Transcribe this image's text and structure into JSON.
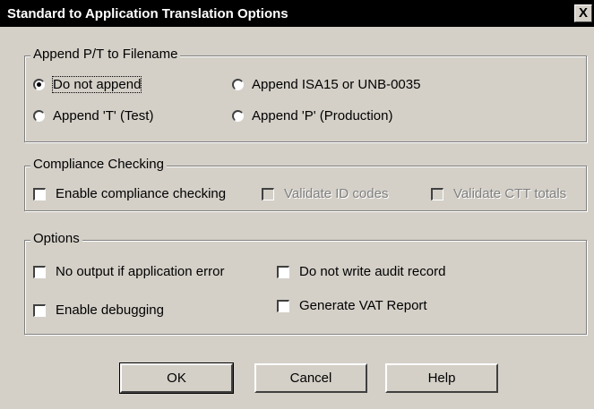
{
  "window": {
    "title": "Standard to Application Translation Options",
    "close_label": "X"
  },
  "append_group": {
    "legend": "Append P/T to Filename",
    "options": [
      {
        "label": "Do not append",
        "selected": true
      },
      {
        "label": "Append ISA15 or UNB-0035",
        "selected": false
      },
      {
        "label": "Append 'T' (Test)",
        "selected": false
      },
      {
        "label": "Append 'P' (Production)",
        "selected": false
      }
    ]
  },
  "compliance_group": {
    "legend": "Compliance Checking",
    "options": [
      {
        "label": "Enable compliance checking",
        "checked": false,
        "enabled": true
      },
      {
        "label": "Validate ID codes",
        "checked": false,
        "enabled": false
      },
      {
        "label": "Validate CTT totals",
        "checked": false,
        "enabled": false
      }
    ]
  },
  "options_group": {
    "legend": "Options",
    "options": [
      {
        "label": "No output if application error",
        "checked": false
      },
      {
        "label": "Do not write audit record",
        "checked": false
      },
      {
        "label": "Enable debugging",
        "checked": false
      },
      {
        "label": "Generate VAT Report",
        "checked": false
      }
    ]
  },
  "buttons": {
    "ok": "OK",
    "cancel": "Cancel",
    "help": "Help"
  }
}
